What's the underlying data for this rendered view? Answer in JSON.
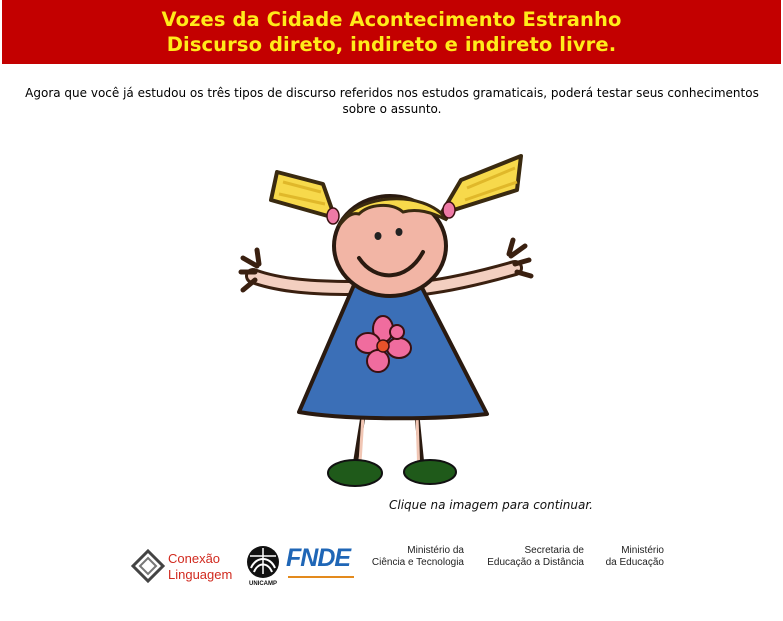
{
  "header": {
    "title_line1": "Vozes da Cidade Acontecimento Estranho",
    "title_line2": "Discurso direto, indireto e indireto livre."
  },
  "intro_text": "Agora que você já estudou os três tipos de discurso referidos nos estudos gramaticais, poderá testar seus conhecimentos sobre o assunto.",
  "illustration": {
    "icon": "girl-drawing"
  },
  "caption": "Clique na imagem para continuar.",
  "footer": {
    "conexao": {
      "line1": "Conexão",
      "line2": "Linguagem"
    },
    "unicamp": "UNICAMP",
    "fnde": "FNDE",
    "ministerio_ct": {
      "line1": "Ministério da",
      "line2": "Ciência e Tecnologia"
    },
    "secretaria": {
      "line1": "Secretaria de",
      "line2": "Educação a Distância"
    },
    "ministerio_ed": {
      "line1": "Ministério",
      "line2": "da Educação"
    }
  },
  "colors": {
    "header_bg": "#c30000",
    "header_text": "#ffeb1a",
    "conexao_red": "#d12a1f",
    "fnde_blue": "#1f66b6"
  }
}
